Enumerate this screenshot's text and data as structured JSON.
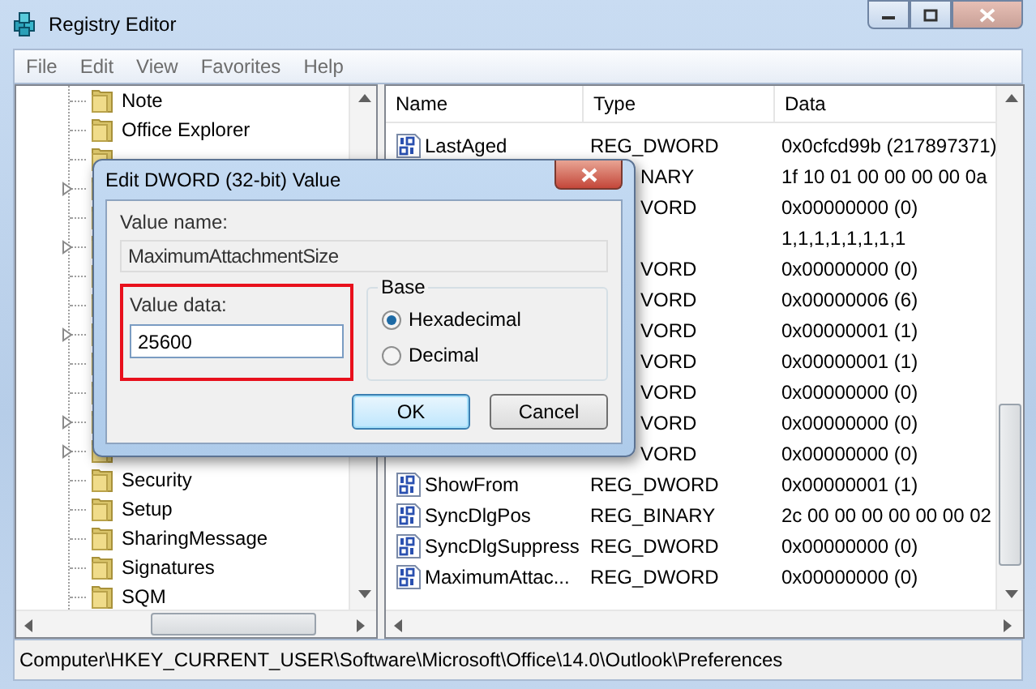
{
  "window": {
    "title": "Registry Editor"
  },
  "menu": [
    "File",
    "Edit",
    "View",
    "Favorites",
    "Help"
  ],
  "tree": {
    "items": [
      {
        "name": "Note",
        "expandable": false
      },
      {
        "name": "Office Explorer",
        "expandable": false
      },
      {
        "expandable": false
      },
      {
        "expandable": true
      },
      {
        "expandable": false
      },
      {
        "expandable": true
      },
      {
        "expandable": false
      },
      {
        "expandable": false
      },
      {
        "expandable": true
      },
      {
        "expandable": false
      },
      {
        "expandable": false
      },
      {
        "expandable": true
      },
      {
        "expandable": true
      },
      {
        "name": "Security",
        "expandable": false
      },
      {
        "name": "Setup",
        "expandable": false
      },
      {
        "name": "SharingMessage",
        "expandable": false
      },
      {
        "name": "Signatures",
        "expandable": false
      },
      {
        "name": "SQM",
        "expandable": false
      }
    ]
  },
  "values": {
    "columns": [
      "Name",
      "Type",
      "Data"
    ],
    "rows": [
      {
        "kind": "full",
        "name": "LastAged",
        "type": "REG_DWORD",
        "data": "0x0cfcd99b (217897371)"
      },
      {
        "kind": "covered",
        "type": "NARY",
        "data": "1f 10 01 00 00 00 00 0a"
      },
      {
        "kind": "covered",
        "type": "VORD",
        "data": "0x00000000 (0)"
      },
      {
        "kind": "covered",
        "data": "1,1,1,1,1,1,1,1"
      },
      {
        "kind": "covered",
        "type": "VORD",
        "data": "0x00000000 (0)"
      },
      {
        "kind": "covered",
        "type": "VORD",
        "data": "0x00000006 (6)"
      },
      {
        "kind": "covered",
        "type": "VORD",
        "data": "0x00000001 (1)"
      },
      {
        "kind": "covered",
        "type": "VORD",
        "data": "0x00000001 (1)"
      },
      {
        "kind": "covered",
        "type": "VORD",
        "data": "0x00000000 (0)"
      },
      {
        "kind": "covered",
        "type": "VORD",
        "data": "0x00000000 (0)"
      },
      {
        "kind": "covered",
        "type": "VORD",
        "data": "0x00000000 (0)"
      },
      {
        "kind": "full",
        "name": "ShowFrom",
        "type": "REG_DWORD",
        "data": "0x00000001 (1)"
      },
      {
        "kind": "full",
        "name": "SyncDlgPos",
        "type": "REG_BINARY",
        "data": "2c 00 00 00 00 00 00 02"
      },
      {
        "kind": "full",
        "name": "SyncDlgSuppress",
        "type": "REG_DWORD",
        "data": "0x00000000 (0)"
      },
      {
        "kind": "full",
        "name": "MaximumAttac...",
        "type": "REG_DWORD",
        "data": "0x00000000 (0)"
      }
    ]
  },
  "status_bar": "Computer\\HKEY_CURRENT_USER\\Software\\Microsoft\\Office\\14.0\\Outlook\\Preferences",
  "dialog": {
    "title": "Edit DWORD (32-bit) Value",
    "value_name_label": "Value name:",
    "value_name": "MaximumAttachmentSize",
    "value_data_label": "Value data:",
    "value_data": "25600",
    "highlighted": true,
    "base_label": "Base",
    "base_options": [
      {
        "label": "Hexadecimal",
        "selected": true
      },
      {
        "label": "Decimal",
        "selected": false
      }
    ],
    "buttons": [
      {
        "label": "OK",
        "default": true
      },
      {
        "label": "Cancel",
        "default": false
      }
    ]
  }
}
